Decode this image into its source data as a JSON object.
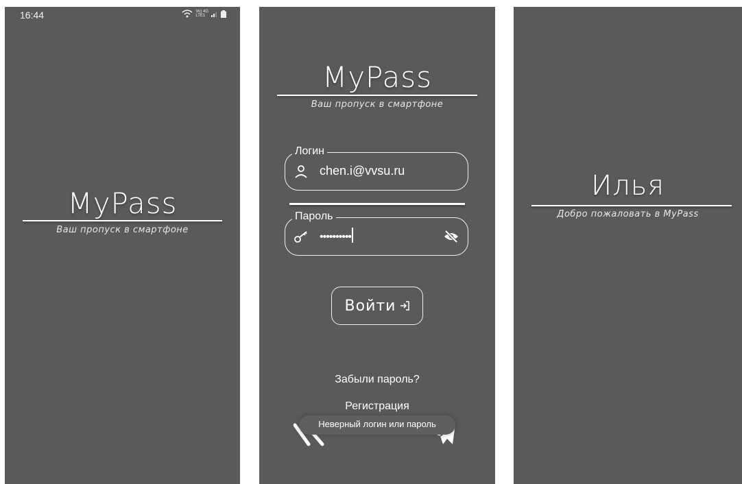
{
  "splash": {
    "status_time": "16:44",
    "status_icons": [
      "wifi-icon",
      "volte-4g-lte-icon",
      "signal-icon",
      "battery-icon"
    ],
    "status_net_top": "Vo) 4G",
    "status_net_bottom": "LTE1",
    "logo": "MyPass",
    "tagline": "Ваш пропуск в смартфоне"
  },
  "login": {
    "logo": "MyPass",
    "tagline": "Ваш пропуск в смартфоне",
    "login_label": "Логин",
    "login_value": "chen.i@vvsu.ru",
    "password_label": "Пароль",
    "password_value": "••••••••••",
    "submit_label": "Войти",
    "forgot_label": "Забыли пароль?",
    "register_label": "Регистрация",
    "toast": "Неверный логин или пароль"
  },
  "welcome": {
    "name": "Илья",
    "message": "Добро пожаловать в MyPass"
  },
  "colors": {
    "screen_bg": "#5a5a5a",
    "text": "#ffffff",
    "page_bg": "#ffffff"
  }
}
